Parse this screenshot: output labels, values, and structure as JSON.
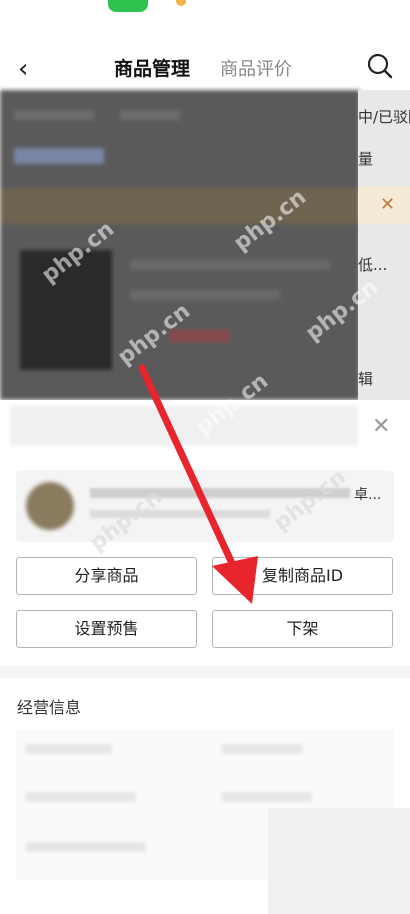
{
  "nav": {
    "back_icon": "chevron-left-icon",
    "tab_active": "商品管理",
    "tab_inactive": "商品评价",
    "search_icon": "search-icon"
  },
  "background_right": {
    "row1": "中/已驳回",
    "row2": "量",
    "row3": "低...",
    "row4": "辑"
  },
  "product": {
    "trailing_text": "卓..."
  },
  "actions": {
    "share": "分享商品",
    "copy_id": "复制商品ID",
    "presale": "设置预售",
    "delist": "下架"
  },
  "section": {
    "title": "经营信息"
  },
  "watermark": "php.cn",
  "colors": {
    "annotation_arrow": "#e8242c",
    "status_pill": "#2fc24f"
  }
}
